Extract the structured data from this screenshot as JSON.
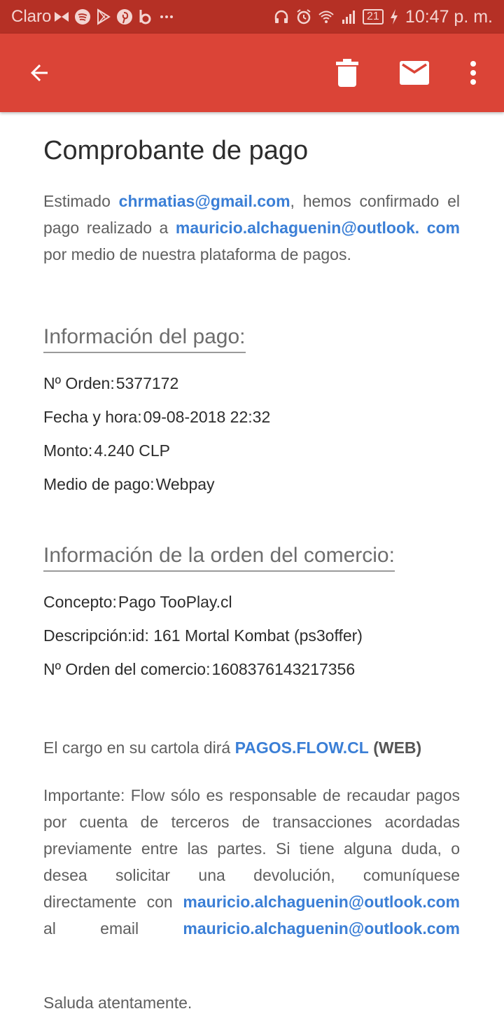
{
  "status_bar": {
    "carrier": "Claro",
    "battery": "21",
    "clock": "10:47 p. m.",
    "icons": [
      "butterfly-icon",
      "spotify-icon",
      "play-store-icon",
      "pinterest-icon",
      "beats-icon",
      "more-dots-icon",
      "headset-icon",
      "alarm-icon",
      "wifi-icon",
      "signal-icon",
      "battery-icon",
      "charging-icon"
    ]
  },
  "app_bar": {
    "actions": [
      "back-icon",
      "trash-icon",
      "mail-icon",
      "more-vert-icon"
    ],
    "accent": "#db4437"
  },
  "email": {
    "title": "Comprobante de pago",
    "intro": {
      "t1": "Estimado ",
      "email1": "chrmatias@gmail.com",
      "t2": ", hemos confirmado el pago realizado a ",
      "email2a": "mauricio.alchaguenin@outlook.",
      "email2b": "com",
      "t3": " por medio de nuestra plataforma de pagos."
    },
    "payment_section": {
      "title": "Información del pago:",
      "rows": [
        {
          "label": "Nº Orden:",
          "value": "5377172"
        },
        {
          "label": "Fecha y hora:",
          "value": "09-08-2018 22:32"
        },
        {
          "label": "Monto:",
          "value": "4.240 CLP"
        },
        {
          "label": "Medio de pago:",
          "value": "Webpay"
        }
      ]
    },
    "order_section": {
      "title": "Información de la orden del comercio:",
      "rows": [
        {
          "label": "Concepto:",
          "value": "Pago TooPlay.cl"
        },
        {
          "label": "Descripción:",
          "value": "id: 161 Mortal Kombat (ps3offer)"
        },
        {
          "label": "Nº Orden del comercio:",
          "value": "1608376143217356"
        }
      ]
    },
    "charge": {
      "t1": "El cargo en su cartola dirá ",
      "link": "PAGOS.FLOW.CL",
      "t2": " ",
      "bold": "(WEB)"
    },
    "important": {
      "t1": "Importante: Flow sólo es responsable de recaudar pagos por cuenta de terceros de transacciones acordadas previamente entre las partes. Si tiene alguna duda, o desea solicitar una devolución, comuníquese directamente con ",
      "link1": "mauricio.alchaguenin@outlook.com",
      "t2": " al email ",
      "link2": "mauricio.alchaguenin@outlook.com"
    },
    "closing": "Saluda atentamente."
  }
}
